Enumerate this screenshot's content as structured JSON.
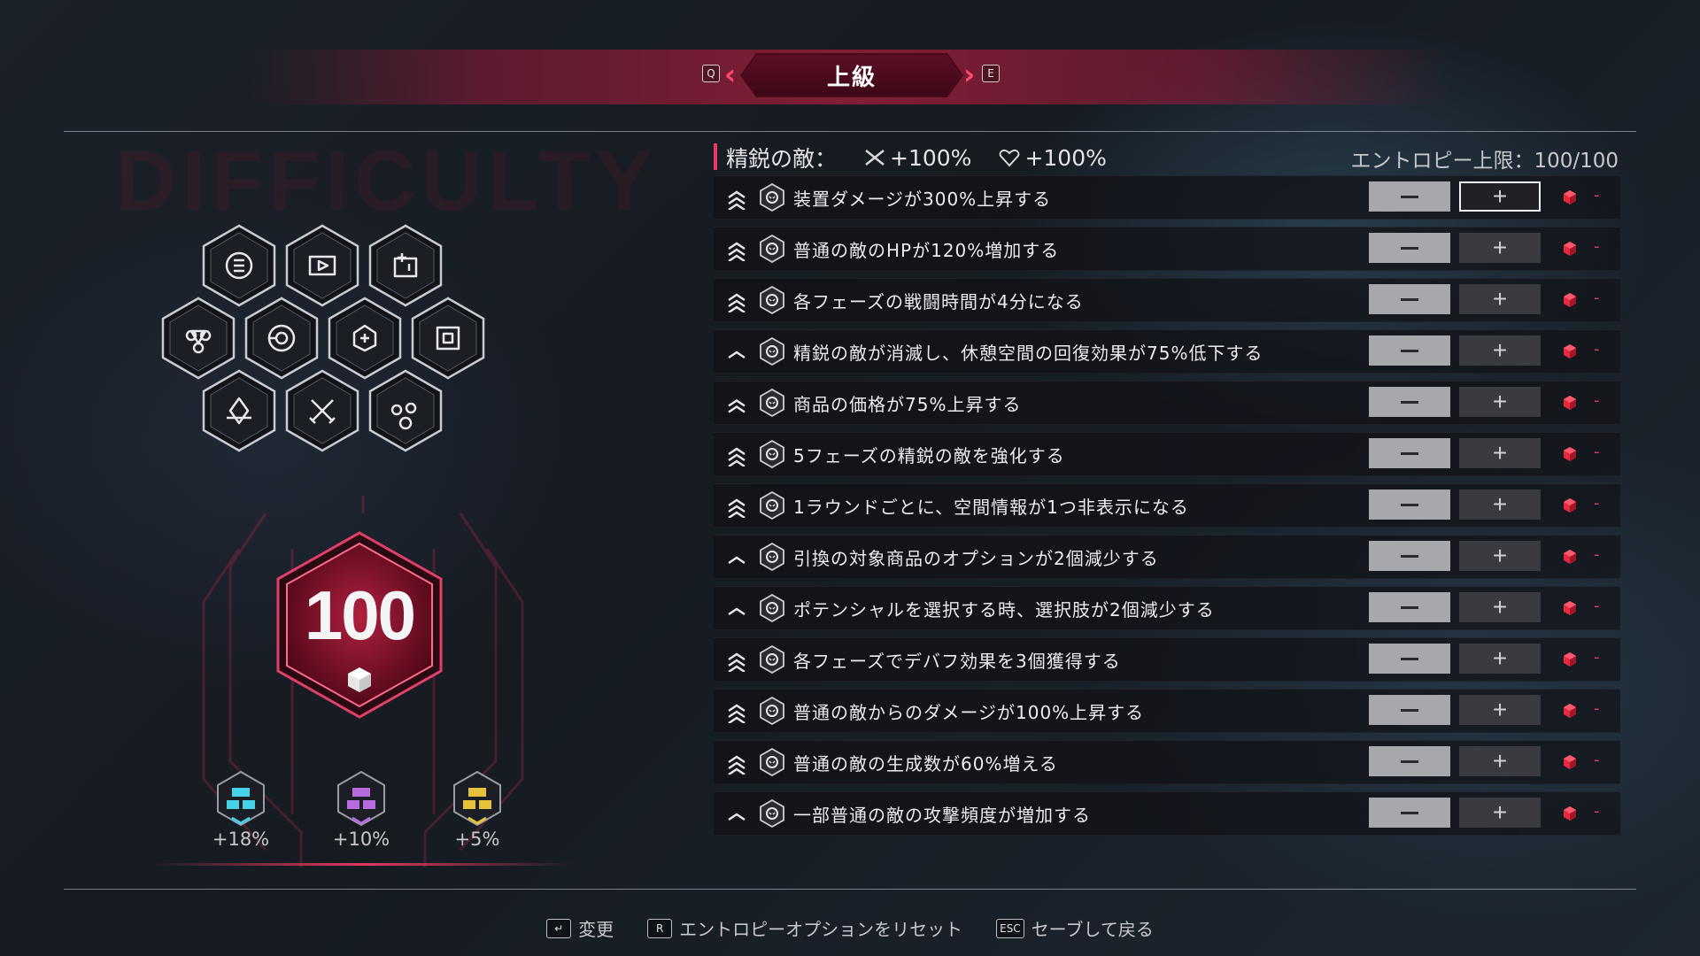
{
  "header": {
    "title": "上級",
    "prev_key": "Q",
    "next_key": "E"
  },
  "watermark": "DIFFICULTY",
  "left_panel": {
    "icons": [
      "currency-icon",
      "play-hex-icon",
      "tower-plus-icon",
      "cluster-icon",
      "swirl-icon",
      "shield-gem-icon",
      "tablet-icon",
      "arrow-hex-icon",
      "crossed-swords-icon",
      "gear-cluster-icon"
    ],
    "entropy_value": "100",
    "bonuses": [
      {
        "label": "+18%",
        "color": "#45d1e6",
        "icon": "cyan-tier-icon"
      },
      {
        "label": "+10%",
        "color": "#b86adf",
        "icon": "purple-tier-icon"
      },
      {
        "label": "+5%",
        "color": "#e6c23a",
        "icon": "gold-tier-icon"
      }
    ]
  },
  "options_header": {
    "title": "精鋭の敵：",
    "attack_bonus": "+100%",
    "hp_bonus": "+100%",
    "entropy_limit": "エントロピー上限：100/100"
  },
  "options": [
    {
      "text": "装置ダメージが300%上昇する",
      "rank": 3,
      "icon": "crossed-blades-icon",
      "selected_plus": true
    },
    {
      "text": "普通の敵のHPが120%増加する",
      "rank": 3,
      "icon": "skull-hex-icon",
      "selected_plus": false
    },
    {
      "text": "各フェーズの戦闘時間が4分になる",
      "rank": 3,
      "icon": "hourglass-icon",
      "selected_plus": false
    },
    {
      "text": "精鋭の敵が消滅し、休憩空間の回復効果が75%低下する",
      "rank": 1,
      "icon": "heart-down-icon",
      "selected_plus": false
    },
    {
      "text": "商品の価格が75%上昇する",
      "rank": 2,
      "icon": "price-tag-icon",
      "selected_plus": false
    },
    {
      "text": "5フェーズの精鋭の敵を強化する",
      "rank": 3,
      "icon": "elite-skull-icon",
      "selected_plus": false
    },
    {
      "text": "1ラウンドごとに、空間情報が1つ非表示になる",
      "rank": 3,
      "icon": "question-icon",
      "selected_plus": false
    },
    {
      "text": "引換の対象商品のオプションが2個減少する",
      "rank": 1,
      "icon": "coin-icon",
      "selected_plus": false
    },
    {
      "text": "ポテンシャルを選択する時、選択肢が2個減少する",
      "rank": 1,
      "icon": "potential-icon",
      "selected_plus": false
    },
    {
      "text": "各フェーズでデバフ効果を3個獲得する",
      "rank": 3,
      "icon": "debuff-icon",
      "selected_plus": false
    },
    {
      "text": "普通の敵からのダメージが100%上昇する",
      "rank": 3,
      "icon": "skull-fang-icon",
      "selected_plus": false
    },
    {
      "text": "普通の敵の生成数が60%増える",
      "rank": 3,
      "icon": "skull-spawn-icon",
      "selected_plus": false
    },
    {
      "text": "一部普通の敵の攻撃頻度が増加する",
      "rank": 1,
      "icon": "skull-claw-icon",
      "selected_plus": false
    }
  ],
  "footer": [
    {
      "key": "↵",
      "label": "変更"
    },
    {
      "key": "R",
      "label": "エントロピーオプションをリセット"
    },
    {
      "key": "ESC",
      "label": "セーブして戻る"
    }
  ],
  "colors": {
    "accent": "#e63a5e",
    "cube": "#e8283c",
    "header_band": "#a81e3c"
  }
}
